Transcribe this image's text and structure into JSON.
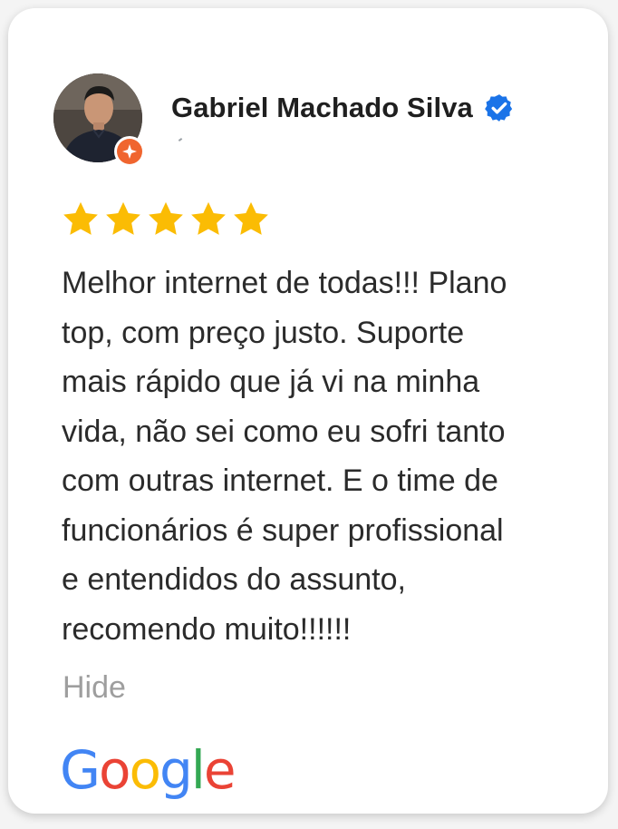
{
  "reviewer": {
    "name": "Gabriel Machado Silva",
    "avatar_icon": "user-avatar-photo",
    "badge_icon": "local-guide-badge-icon",
    "verified_icon": "verified-check-icon"
  },
  "rating": {
    "value": 5,
    "max": 5,
    "star_color": "#FBBC04"
  },
  "review": {
    "text": "Melhor internet de todas!!! Plano\ntop, com preço justo. Suporte\nmais rápido que já vi na minha\nvida, não sei como eu sofri tanto\ncom outras internet. E o time de\nfuncionários é super profissional\ne entendidos do assunto,\nrecomendo muito!!!!!!",
    "toggle_label": "Hide"
  },
  "brand": {
    "letters": [
      "G",
      "o",
      "o",
      "g",
      "l",
      "e"
    ],
    "colors": {
      "blue": "#4285F4",
      "red": "#EA4335",
      "yellow": "#FBBC05",
      "green": "#34A853"
    }
  },
  "colors": {
    "verified_blue": "#1A73E8",
    "badge_orange": "#F0652F",
    "text": "#2B2B2B",
    "muted": "#9E9E9E"
  }
}
